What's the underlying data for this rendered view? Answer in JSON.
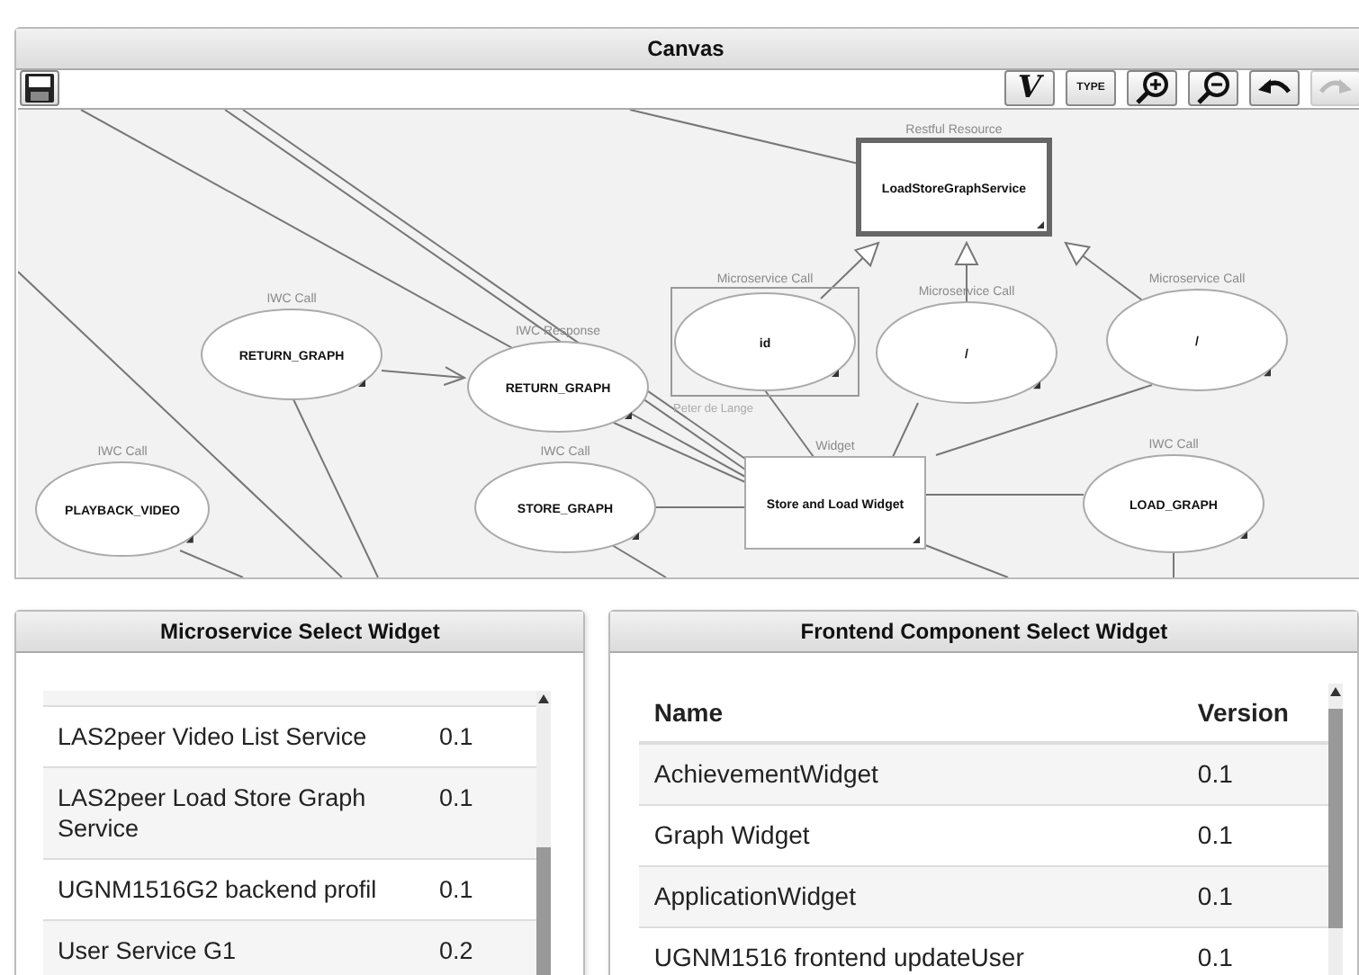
{
  "canvas": {
    "title": "Canvas",
    "toolbar": [
      {
        "kind": "save"
      },
      {
        "kind": "vimeo",
        "label": "V"
      },
      {
        "kind": "type",
        "label": "TYPE"
      },
      {
        "kind": "zoom_in"
      },
      {
        "kind": "zoom_out"
      },
      {
        "kind": "undo"
      },
      {
        "kind": "redo",
        "disabled": true
      }
    ],
    "nodes": [
      {
        "kind": "resource",
        "type_label": "Restful Resource",
        "name": "LoadStoreGraphService"
      },
      {
        "kind": "ellipse",
        "type_label": "IWC Call",
        "name": "RETURN_GRAPH"
      },
      {
        "kind": "ellipse",
        "type_label": "IWC Response",
        "name": "RETURN_GRAPH"
      },
      {
        "kind": "ellipse",
        "type_label": "Microservice Call",
        "name": "id",
        "selected_by": "Peter de Lange"
      },
      {
        "kind": "ellipse",
        "type_label": "Microservice Call",
        "name": "/"
      },
      {
        "kind": "ellipse",
        "type_label": "Microservice Call",
        "name": "/"
      },
      {
        "kind": "ellipse",
        "type_label": "IWC Call",
        "name": "PLAYBACK_VIDEO"
      },
      {
        "kind": "ellipse",
        "type_label": "IWC Call",
        "name": "STORE_GRAPH"
      },
      {
        "kind": "widget",
        "type_label": "Widget",
        "name": "Store and Load Widget"
      },
      {
        "kind": "ellipse",
        "type_label": "IWC Call",
        "name": "LOAD_GRAPH"
      }
    ]
  },
  "microservice_widget": {
    "title": "Microservice Select Widget",
    "rows": [
      {
        "name": "LAS2peer Video List Service",
        "version": "0.1"
      },
      {
        "name": "LAS2peer Load Store Graph Service",
        "version": "0.1"
      },
      {
        "name": "UGNM1516G2 backend profil",
        "version": "0.1"
      },
      {
        "name": "User Service G1",
        "version": "0.2"
      }
    ]
  },
  "frontend_widget": {
    "title": "Frontend Component Select Widget",
    "columns": [
      "Name",
      "Version"
    ],
    "rows": [
      {
        "name": "AchievementWidget",
        "version": "0.1"
      },
      {
        "name": "Graph Widget",
        "version": "0.1"
      },
      {
        "name": "ApplicationWidget",
        "version": "0.1"
      },
      {
        "name": "UGNM1516 frontend updateUser",
        "version": "0.1"
      }
    ]
  }
}
